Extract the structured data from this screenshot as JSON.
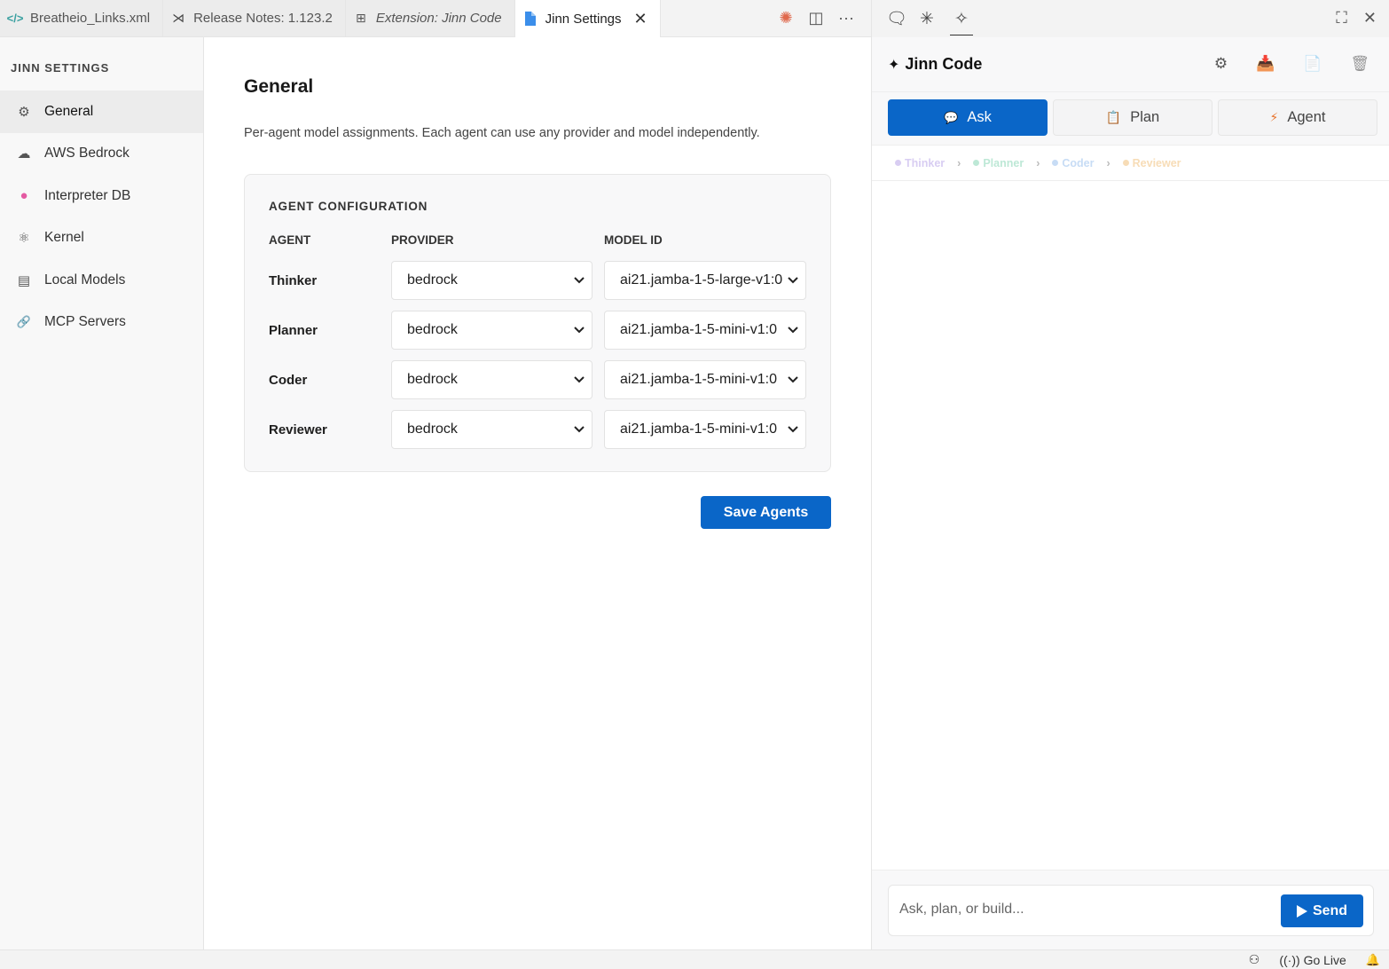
{
  "tabs": [
    {
      "label": "Breatheio_Links.xml",
      "icon": "code-icon",
      "icon_glyph": "</>",
      "icon_color": "#3aa0a0",
      "italic": false
    },
    {
      "label": "Release Notes: 1.123.2",
      "icon": "vscode-icon",
      "icon_glyph": "⋊",
      "icon_color": "#444444",
      "italic": false
    },
    {
      "label": "Extension: Jinn Code",
      "icon": "extensions-icon",
      "icon_glyph": "⊞",
      "icon_color": "#555555",
      "italic": true
    },
    {
      "label": "Jinn Settings",
      "icon": "file-icon",
      "icon_glyph": "▮",
      "icon_color": "#3b8eea",
      "italic": false,
      "active": true
    }
  ],
  "tab_actions": {
    "sparkle": "✺",
    "split": "◫",
    "more": "···"
  },
  "sidebar": {
    "title": "JINN SETTINGS",
    "items": [
      {
        "label": "General",
        "icon": "gear-icon",
        "glyph": "⚙",
        "active": true
      },
      {
        "label": "AWS Bedrock",
        "icon": "cloud-icon",
        "glyph": "☁"
      },
      {
        "label": "Interpreter DB",
        "icon": "brain-icon",
        "glyph": "●"
      },
      {
        "label": "Kernel",
        "icon": "atom-icon",
        "glyph": "⚛"
      },
      {
        "label": "Local Models",
        "icon": "document-icon",
        "glyph": "▤"
      },
      {
        "label": "MCP Servers",
        "icon": "link-icon",
        "glyph": "🔗"
      }
    ]
  },
  "main": {
    "title": "General",
    "description": "Per-agent model assignments. Each agent can use any provider and model independently.",
    "card_title": "AGENT CONFIGURATION",
    "columns": {
      "agent": "AGENT",
      "provider": "PROVIDER",
      "model": "MODEL ID"
    },
    "agents": [
      {
        "name": "Thinker",
        "provider": "bedrock",
        "model": "ai21.jamba-1-5-large-v1:0"
      },
      {
        "name": "Planner",
        "provider": "bedrock",
        "model": "ai21.jamba-1-5-mini-v1:0"
      },
      {
        "name": "Coder",
        "provider": "bedrock",
        "model": "ai21.jamba-1-5-mini-v1:0"
      },
      {
        "name": "Reviewer",
        "provider": "bedrock",
        "model": "ai21.jamba-1-5-mini-v1:0"
      }
    ],
    "save_label": "Save Agents"
  },
  "right_panel": {
    "top_icons": {
      "chat": "🗨",
      "sparkle": "✳",
      "wand": "✧"
    },
    "top_right": {
      "maximize": "⛶",
      "close": "✕"
    },
    "logo": "✦",
    "title": "Jinn Code",
    "header_actions": {
      "settings": "⚙",
      "inbox": "📥",
      "doc": "📄",
      "trash": "🗑"
    },
    "modes": [
      {
        "label": "Ask",
        "icon": "chat-bubble-icon",
        "glyph": "💬",
        "active": true
      },
      {
        "label": "Plan",
        "icon": "clipboard-icon",
        "glyph": "📋"
      },
      {
        "label": "Agent",
        "icon": "lightning-icon",
        "glyph": "⚡"
      }
    ],
    "pipeline": [
      {
        "label": "Thinker",
        "color": "#d8cdf2"
      },
      {
        "label": "Planner",
        "color": "#bde8d6"
      },
      {
        "label": "Coder",
        "color": "#c7dcf5"
      },
      {
        "label": "Reviewer",
        "color": "#f7dcb6"
      }
    ],
    "input_placeholder": "Ask, plan, or build...",
    "send_label": "Send"
  },
  "status": {
    "copilot": "⚇",
    "go_live": "Go Live",
    "bell": "🔔"
  },
  "colors": {
    "accent": "#0a66c8"
  }
}
